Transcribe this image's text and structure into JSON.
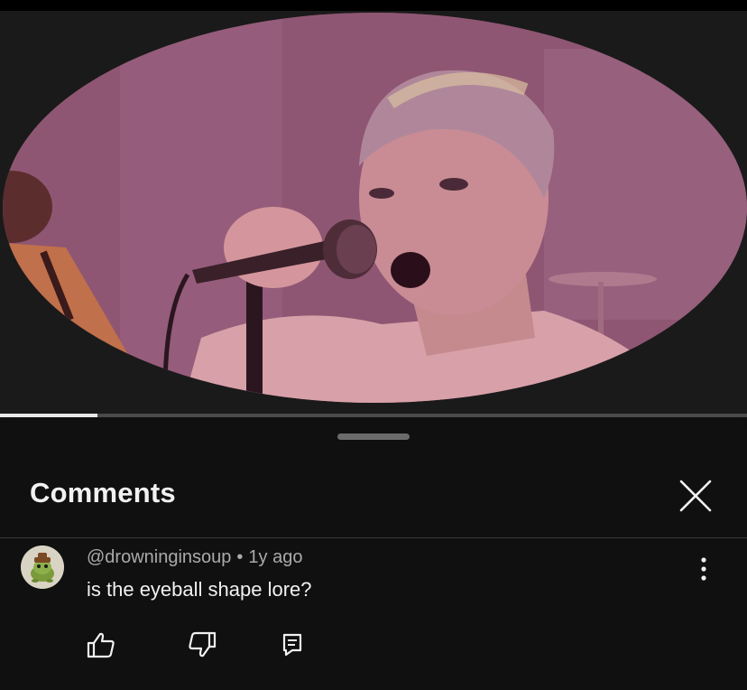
{
  "video": {
    "progress_fraction": 0.13,
    "tint_color": "#925a78"
  },
  "comments_sheet": {
    "title": "Comments",
    "close_icon": "close-icon"
  },
  "comments": [
    {
      "author": "@drowninginsoup",
      "separator": "•",
      "time": "1y ago",
      "text": "is the eyeball shape lore?",
      "avatar_icon": "frog-avatar",
      "actions": {
        "like_icon": "thumbs-up-icon",
        "dislike_icon": "thumbs-down-icon",
        "reply_icon": "reply-icon",
        "more_icon": "more-vert-icon"
      }
    }
  ],
  "colors": {
    "background": "#0f0f0f",
    "text_primary": "#f1f1f1",
    "text_secondary": "#aaaaaa",
    "divider": "#3a3a3a",
    "handle": "#6b6b6b"
  }
}
